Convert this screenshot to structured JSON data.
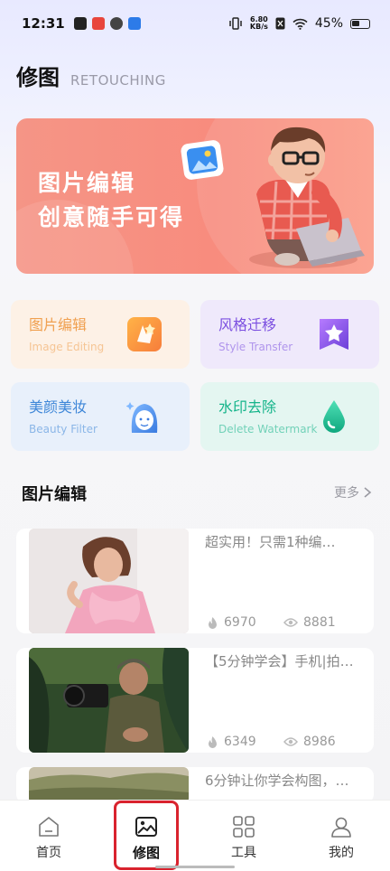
{
  "status_bar": {
    "time": "12:31",
    "net_speed_value": "6.80",
    "net_speed_unit": "KB/s",
    "battery": "45%"
  },
  "header": {
    "title": "修图",
    "subtitle": "RETOUCHING"
  },
  "banner": {
    "line1": "图片编辑",
    "line2": "创意随手可得"
  },
  "features": [
    {
      "title": "图片编辑",
      "subtitle": "Image Editing",
      "icon": "image-edit-icon",
      "color": "#f0a050"
    },
    {
      "title": "风格迁移",
      "subtitle": "Style Transfer",
      "icon": "star-icon",
      "color": "#7b4fe0"
    },
    {
      "title": "美颜美妆",
      "subtitle": "Beauty Filter",
      "icon": "face-icon",
      "color": "#3f87d8"
    },
    {
      "title": "水印去除",
      "subtitle": "Delete Watermark",
      "icon": "drop-icon",
      "color": "#15b48a"
    }
  ],
  "section": {
    "title": "图片编辑",
    "more": "更多"
  },
  "articles": [
    {
      "title": "超实用！只需1种编…",
      "likes": "6970",
      "views": "8881"
    },
    {
      "title": "【5分钟学会】手机|拍…",
      "likes": "6349",
      "views": "8986"
    },
    {
      "title": "6分钟让你学会构图，…",
      "likes": "",
      "views": ""
    }
  ],
  "tabs": [
    {
      "label": "首页",
      "icon": "home-icon"
    },
    {
      "label": "修图",
      "icon": "image-icon"
    },
    {
      "label": "工具",
      "icon": "grid-icon"
    },
    {
      "label": "我的",
      "icon": "user-icon"
    }
  ]
}
